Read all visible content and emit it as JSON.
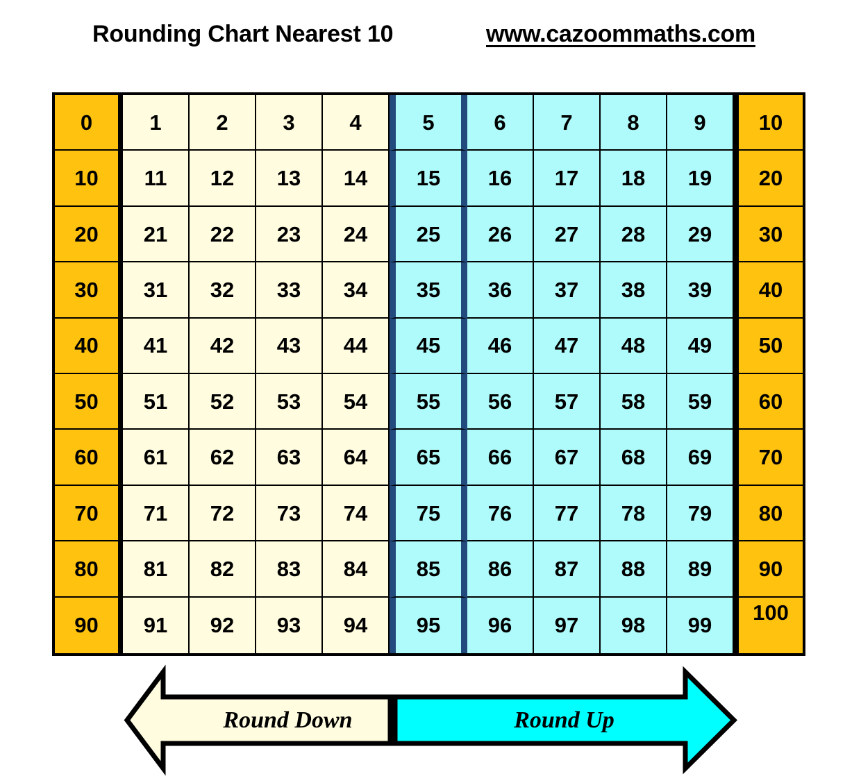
{
  "header": {
    "title": "Rounding Chart Nearest 10",
    "url": "www.cazoommaths.com"
  },
  "legend": {
    "round_down_label": "Round Down",
    "round_up_label": "Round Up"
  },
  "colors": {
    "decade_orange": "#FFC20E",
    "round_down_cream": "#FFFCDF",
    "round_up_cyan": "#AFFBFB",
    "divider_navy": "#234A7D",
    "arrow_down_fill": "#FFFCDF",
    "arrow_up_fill": "#00FFFF",
    "border_black": "#000000"
  },
  "chart_data": {
    "type": "table",
    "title": "Rounding Chart Nearest 10",
    "rows": [
      [
        "0",
        "1",
        "2",
        "3",
        "4",
        "5",
        "6",
        "7",
        "8",
        "9",
        "10"
      ],
      [
        "10",
        "11",
        "12",
        "13",
        "14",
        "15",
        "16",
        "17",
        "18",
        "19",
        "20"
      ],
      [
        "20",
        "21",
        "22",
        "23",
        "24",
        "25",
        "26",
        "27",
        "28",
        "29",
        "30"
      ],
      [
        "30",
        "31",
        "32",
        "33",
        "34",
        "35",
        "36",
        "37",
        "38",
        "39",
        "40"
      ],
      [
        "40",
        "41",
        "42",
        "43",
        "44",
        "45",
        "46",
        "47",
        "48",
        "49",
        "50"
      ],
      [
        "50",
        "51",
        "52",
        "53",
        "54",
        "55",
        "56",
        "57",
        "58",
        "59",
        "60"
      ],
      [
        "60",
        "61",
        "62",
        "63",
        "64",
        "65",
        "66",
        "67",
        "68",
        "69",
        "70"
      ],
      [
        "70",
        "71",
        "72",
        "73",
        "74",
        "75",
        "76",
        "77",
        "78",
        "79",
        "80"
      ],
      [
        "80",
        "81",
        "82",
        "83",
        "84",
        "85",
        "86",
        "87",
        "88",
        "89",
        "90"
      ],
      [
        "90",
        "91",
        "92",
        "93",
        "94",
        "95",
        "96",
        "97",
        "98",
        "99",
        "100"
      ]
    ],
    "column_roles": [
      "decade-target-lower",
      "round-down",
      "round-down",
      "round-down",
      "round-down",
      "round-up",
      "round-up",
      "round-up",
      "round-up",
      "round-up",
      "decade-target-upper"
    ],
    "round_down_digits": [
      "1",
      "2",
      "3",
      "4"
    ],
    "round_up_digits": [
      "5",
      "6",
      "7",
      "8",
      "9"
    ],
    "decade_values_left": [
      "0",
      "10",
      "20",
      "30",
      "40",
      "50",
      "60",
      "70",
      "80",
      "90"
    ],
    "decade_values_right": [
      "10",
      "20",
      "30",
      "40",
      "50",
      "60",
      "70",
      "80",
      "90",
      "100"
    ],
    "grid": true,
    "legend_position": "below"
  }
}
